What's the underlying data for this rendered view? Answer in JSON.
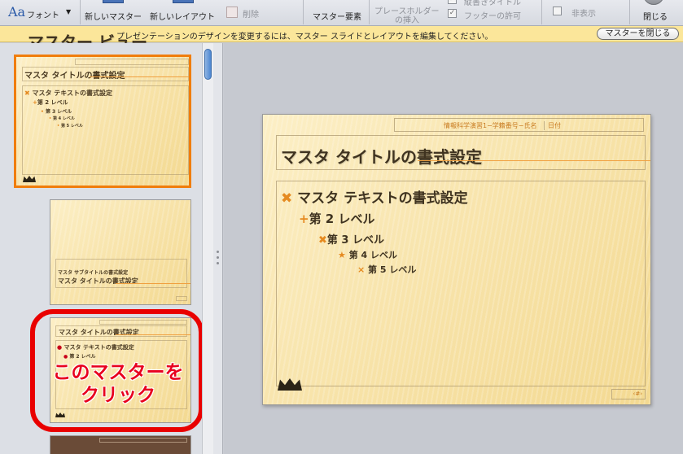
{
  "ribbon": {
    "font_label": "フォント",
    "font_icon": "Aa",
    "new_master": "新しいマスター",
    "new_layout": "新しいレイアウト",
    "delete": "削除",
    "master_elements": "マスター要素",
    "placeholder_insert_1": "プレースホルダー",
    "placeholder_insert_2": "の挿入",
    "vertical_title": "縦書きタイトル",
    "footer_allow": "フッターの許可",
    "hide": "非表示",
    "close": "閉じる"
  },
  "master_bar": {
    "title": "マスター ビュー",
    "message": "プレゼンテーションのデザインを変更するには、マスター スライドとレイアウトを編集してください。",
    "close_button": "マスターを閉じる"
  },
  "slide": {
    "header_center": "情報科学演習1−学籍番号−氏名",
    "header_date": "日付",
    "title": "マスタ タイトルの書式設定",
    "levels": [
      "マスタ テキストの書式設定",
      "第 2 レベル",
      "第 3 レベル",
      "第 4 レベル",
      "第 5 レベル"
    ],
    "page_number": "‹#›"
  },
  "thumb2": {
    "subtitle": "マスタ サブタイトルの書式設定",
    "title": "マスタ タイトルの書式設定"
  },
  "annotation": {
    "line1": "このマスターを",
    "line2": "クリック"
  },
  "colors": {
    "accent_orange": "#f07d0c",
    "annotation_red": "#e90000",
    "master_bar_yellow": "#fbe69a"
  }
}
